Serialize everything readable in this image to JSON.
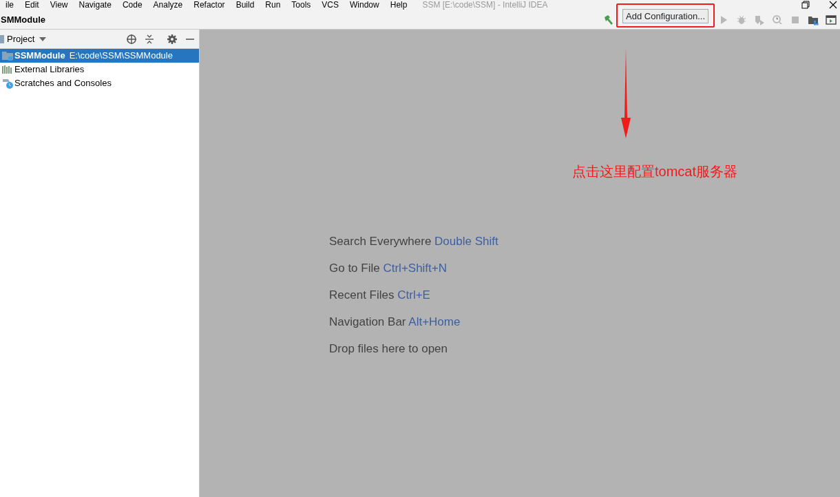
{
  "menu": [
    "ile",
    "Edit",
    "View",
    "Navigate",
    "Code",
    "Analyze",
    "Refactor",
    "Build",
    "Run",
    "Tools",
    "VCS",
    "Window",
    "Help"
  ],
  "window": {
    "title": "SSM [E:\\code\\SSM] - IntelliJ IDEA"
  },
  "breadcrumb": "SMModule",
  "toolbar": {
    "configuration": "Add Configuration..."
  },
  "project_panel": {
    "title": "Project",
    "tree": [
      {
        "kind": "module",
        "label": "SSMModule",
        "path": "E:\\code\\SSM\\SSMModule",
        "selected": true
      },
      {
        "kind": "libraries",
        "label": "External Libraries",
        "selected": false
      },
      {
        "kind": "scratches",
        "label": "Scratches and Consoles",
        "selected": false
      }
    ]
  },
  "editor_hints": [
    {
      "text": "Search Everywhere",
      "shortcut": "Double Shift"
    },
    {
      "text": "Go to File",
      "shortcut": "Ctrl+Shift+N"
    },
    {
      "text": "Recent Files",
      "shortcut": "Ctrl+E"
    },
    {
      "text": "Navigation Bar",
      "shortcut": "Alt+Home"
    },
    {
      "text": "Drop files here to open"
    }
  ],
  "annotation": {
    "text": "点击这里配置tomcat服务器"
  }
}
